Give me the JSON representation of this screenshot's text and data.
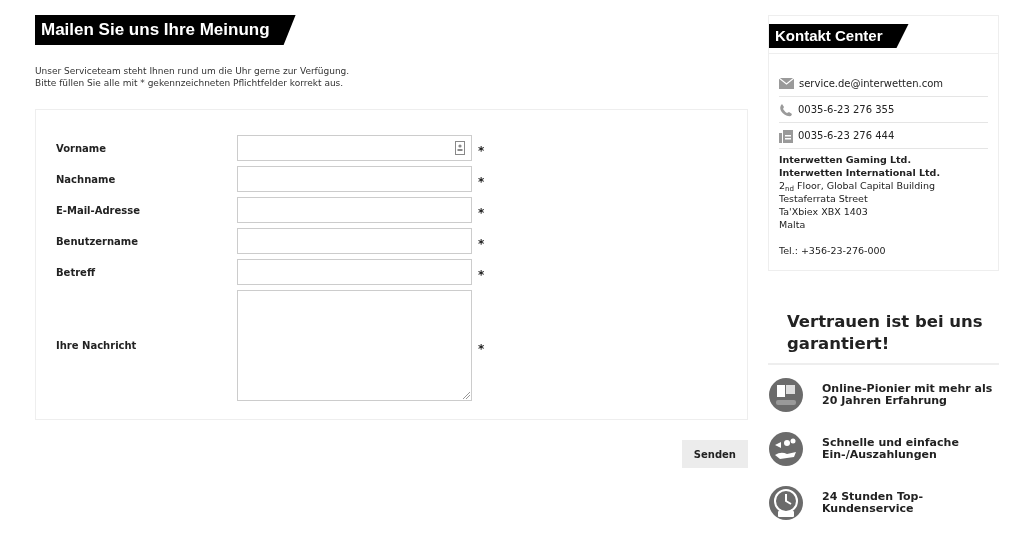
{
  "form": {
    "title": "Mailen Sie uns Ihre Meinung",
    "intro": [
      "Unser Serviceteam steht Ihnen rund um die Uhr gerne zur Verfügung.",
      "Bitte füllen Sie alle mit * gekennzeichneten Pflichtfelder korrekt aus."
    ],
    "fields": [
      {
        "label": "Vorname",
        "kind": "input",
        "has_icon": true,
        "required": "*"
      },
      {
        "label": "Nachname",
        "kind": "input",
        "has_icon": false,
        "required": "*"
      },
      {
        "label": "E-Mail-Adresse",
        "kind": "input",
        "has_icon": false,
        "required": "*"
      },
      {
        "label": "Benutzername",
        "kind": "input",
        "has_icon": false,
        "required": "*"
      },
      {
        "label": "Betreff",
        "kind": "input",
        "has_icon": false,
        "required": "*"
      },
      {
        "label": "Ihre Nachricht",
        "kind": "textarea",
        "required": "*"
      }
    ],
    "submit": "Senden"
  },
  "contact": {
    "title": "Kontakt Center",
    "rows": [
      {
        "kind": "mail",
        "text": "service.de@interwetten.com"
      },
      {
        "kind": "phone",
        "text": "0035-6-23 276 355"
      },
      {
        "kind": "fax",
        "text": "0035-6-23 276 444"
      }
    ],
    "companies": [
      "Interwetten Gaming Ltd.",
      "Interwetten International Ltd."
    ],
    "address": [
      "2$_{nd}$ Floor, Global Capital Building",
      "Testaferrata Street",
      "Ta'Xbiex XBX 1403",
      "Malta"
    ],
    "tel": "Tel.: +356-23-276-000"
  },
  "trust": {
    "title": "Vertrauen ist bei uns garantiert!",
    "items": [
      {
        "kind": "years",
        "text": "Online-Pionier mit mehr als 20 Jahren Erfahrung"
      },
      {
        "kind": "payments",
        "text": "Schnelle und einfache Ein-/Auszahlungen"
      },
      {
        "kind": "clock",
        "text": "24 Stunden Top-Kundenservice"
      }
    ]
  }
}
